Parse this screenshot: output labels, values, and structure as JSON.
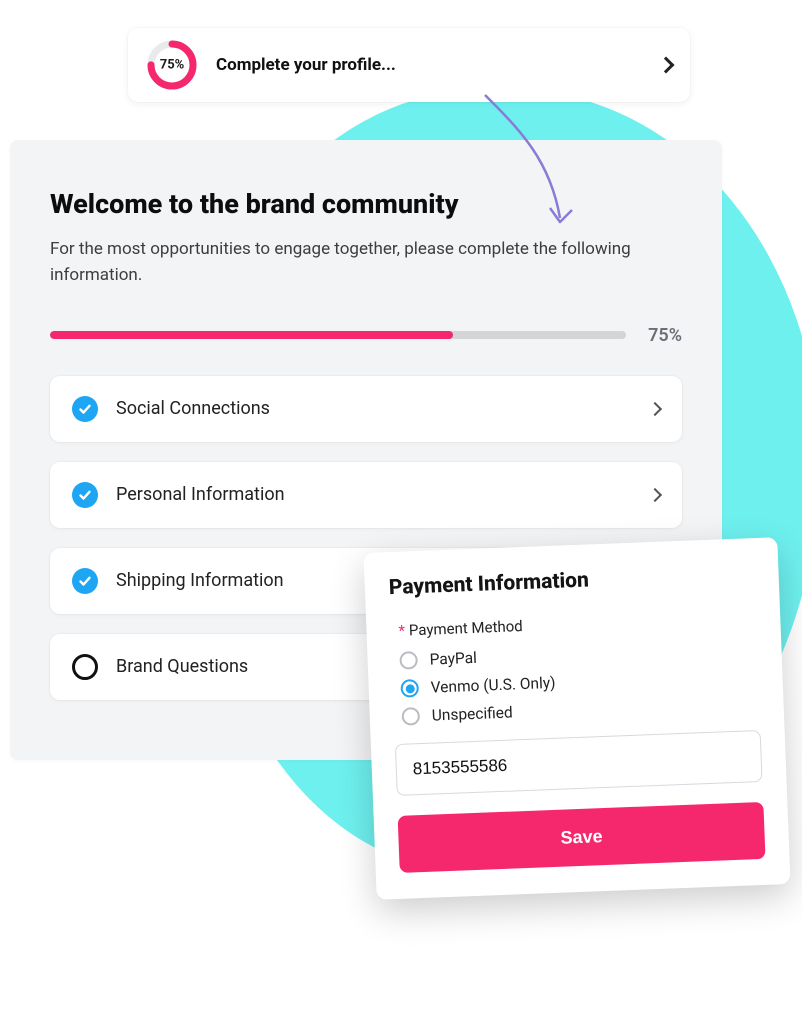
{
  "colors": {
    "accent": "#f5286e",
    "blue": "#1ea5f3",
    "cyan": "#6ef0ef"
  },
  "banner": {
    "percent_label": "75%",
    "percent_value": 75,
    "title": "Complete your profile..."
  },
  "card": {
    "heading": "Welcome to the brand community",
    "subtext": "For the most opportunities to engage together, please complete the following information.",
    "progress_percent_label": "75%",
    "progress_percent_value": 75,
    "sections": [
      {
        "label": "Social Connections",
        "completed": true,
        "expandable": true
      },
      {
        "label": "Personal Information",
        "completed": true,
        "expandable": true
      },
      {
        "label": "Shipping Information",
        "completed": true,
        "expandable": false
      },
      {
        "label": "Brand Questions",
        "completed": false,
        "expandable": false
      }
    ]
  },
  "payment": {
    "title": "Payment Information",
    "field_label": "Payment Method",
    "required_marker": "*",
    "options": [
      {
        "label": "PayPal",
        "selected": false
      },
      {
        "label": "Venmo (U.S. Only)",
        "selected": true
      },
      {
        "label": "Unspecified",
        "selected": false
      }
    ],
    "input_value": "8153555586",
    "save_label": "Save"
  }
}
